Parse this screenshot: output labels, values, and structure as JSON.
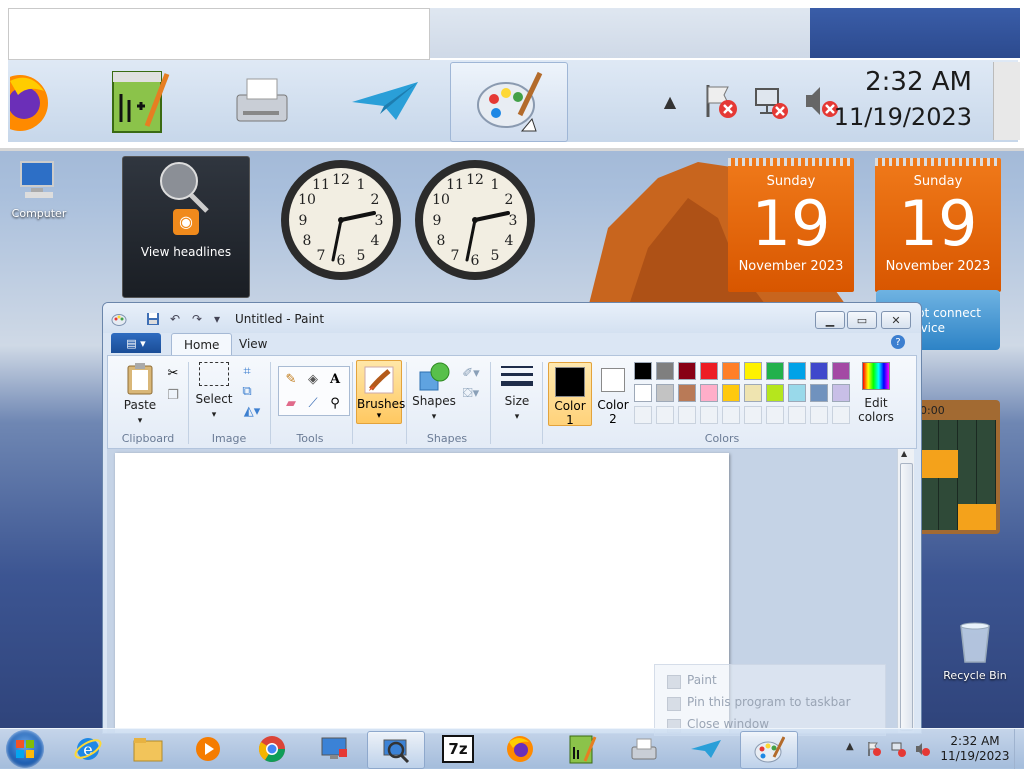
{
  "magnifier": {
    "clock_time": "2:32 AM",
    "clock_date": "11/19/2023"
  },
  "desktop": {
    "icons": [
      {
        "label": "Computer"
      },
      {
        "label": "Recycle Bin"
      }
    ]
  },
  "gadgets": {
    "feed_label": "View headlines",
    "calendars": [
      {
        "dow": "Sunday",
        "day": "19",
        "month": "November 2023"
      },
      {
        "dow": "Sunday",
        "day": "19",
        "month": "November 2023"
      }
    ],
    "weather_text_1": "nnot connect",
    "weather_text_2": "service",
    "puzzle_time": "0:00",
    "clock_numerals": [
      "12",
      "1",
      "2",
      "3",
      "4",
      "5",
      "6",
      "7",
      "8",
      "9",
      "10",
      "11"
    ]
  },
  "paint": {
    "title": "Untitled - Paint",
    "tabs": [
      {
        "label": "Home"
      },
      {
        "label": "View"
      }
    ],
    "help": "?",
    "ribbon": {
      "paste": "Paste",
      "select": "Select",
      "brushes": "Brushes",
      "shapes": "Shapes",
      "size": "Size",
      "color1_a": "Color",
      "color1_b": "1",
      "color2_a": "Color",
      "color2_b": "2",
      "edit_colors_a": "Edit",
      "edit_colors_b": "colors",
      "groups": [
        "Clipboard",
        "Image",
        "Tools",
        "Shapes",
        "Colors"
      ]
    },
    "color1": "#000000",
    "color2": "#ffffff",
    "palette_row1": [
      "#000000",
      "#7f7f7f",
      "#880015",
      "#ed1c24",
      "#ff7f27",
      "#fff200",
      "#22b14c",
      "#00a2e8",
      "#3f48cc",
      "#a349a4"
    ],
    "palette_row2": [
      "#ffffff",
      "#c3c3c3",
      "#b97a57",
      "#ffaec9",
      "#ffc90e",
      "#efe4b0",
      "#b5e61d",
      "#99d9ea",
      "#7092be",
      "#c8bfe7"
    ]
  },
  "jumplist": {
    "items": [
      "Paint",
      "Pin this program to taskbar",
      "Close window"
    ]
  },
  "taskbar": {
    "clock_time": "2:32 AM",
    "clock_date": "11/19/2023",
    "sevenzip": "7z"
  }
}
